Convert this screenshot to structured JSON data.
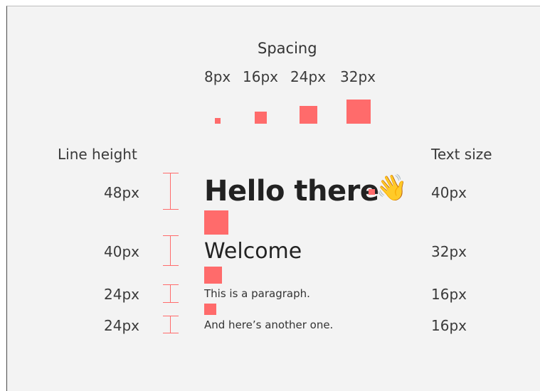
{
  "spacing": {
    "title": "Spacing",
    "sizes": [
      "8px",
      "16px",
      "24px",
      "32px"
    ]
  },
  "columns": {
    "line_height_header": "Line height",
    "text_size_header": "Text size"
  },
  "rows": [
    {
      "line_height": "48px",
      "sample": "Hello there",
      "emoji": "👋",
      "text_size": "40px"
    },
    {
      "line_height": "40px",
      "sample": "Welcome",
      "text_size": "32px"
    },
    {
      "line_height": "24px",
      "sample": "This is a paragraph.",
      "text_size": "16px"
    },
    {
      "line_height": "24px",
      "sample": "And here’s another one.",
      "text_size": "16px"
    }
  ],
  "colors": {
    "accent": "#ff6b6b",
    "background": "#f3f3f3",
    "text": "#333333"
  }
}
